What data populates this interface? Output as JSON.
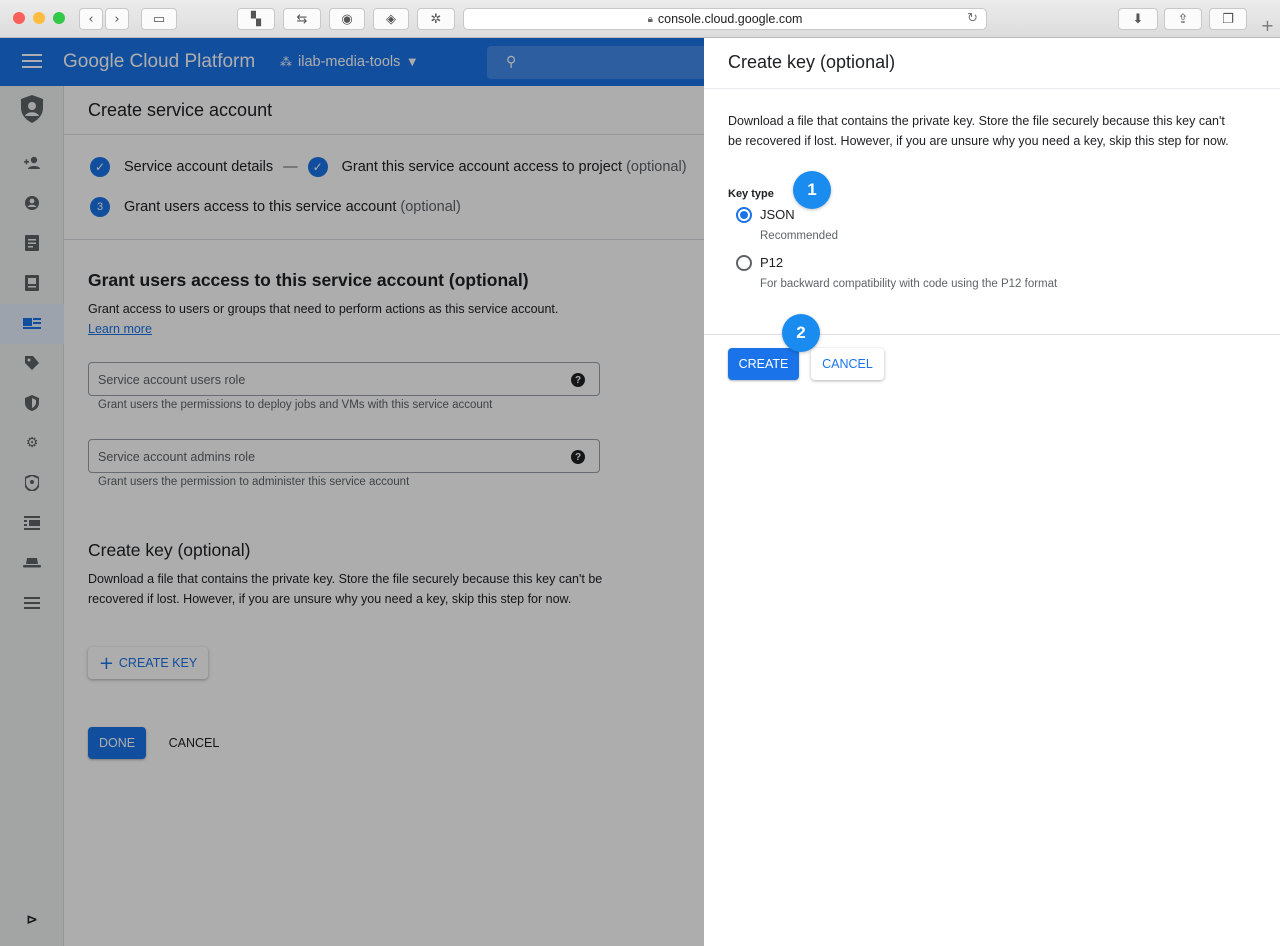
{
  "browser": {
    "url": "console.cloud.google.com"
  },
  "header": {
    "brand": "Google Cloud Platform",
    "project": "ilab-media-tools"
  },
  "steps": {
    "step1": "Service account details",
    "separator": "—",
    "step2": "Grant this service account access to project",
    "step2_optional": "(optional)",
    "step3_number": "3",
    "step3": "Grant users access to this service account",
    "step3_optional": "(optional)"
  },
  "main": {
    "title": "Create service account",
    "grant_heading": "Grant users access to this service account (optional)",
    "grant_desc": "Grant access to users or groups that need to perform actions as this service account.",
    "learn_more": "Learn more",
    "users_role_placeholder": "Service account users role",
    "users_role_hint": "Grant users the permissions to deploy jobs and VMs with this service account",
    "admins_role_placeholder": "Service account admins role",
    "admins_role_hint": "Grant users the permission to administer this service account",
    "help_glyph": "?",
    "key_heading": "Create key (optional)",
    "key_desc": "Download a file that contains the private key. Store the file securely because this key can't be recovered if lost. However, if you are unsure why you need a key, skip this step for now.",
    "create_key_button": "CREATE KEY",
    "done_button": "DONE",
    "cancel_button": "CANCEL"
  },
  "panel": {
    "title": "Create key (optional)",
    "description": "Download a file that contains the private key. Store the file securely because this key can't be recovered if lost. However, if you are unsure why you need a key, skip this step for now.",
    "key_type_label": "Key type",
    "options": [
      {
        "label": "JSON",
        "sub": "Recommended",
        "selected": true
      },
      {
        "label": "P12",
        "sub": "For backward compatibility with code using the P12 format",
        "selected": false
      }
    ],
    "create_button": "CREATE",
    "cancel_button": "CANCEL"
  },
  "annotations": {
    "badge1": "1",
    "badge2": "2",
    "color": "#1a8cf0"
  },
  "colors": {
    "header_blue": "#1a73e8",
    "primary": "#1a73e8"
  }
}
